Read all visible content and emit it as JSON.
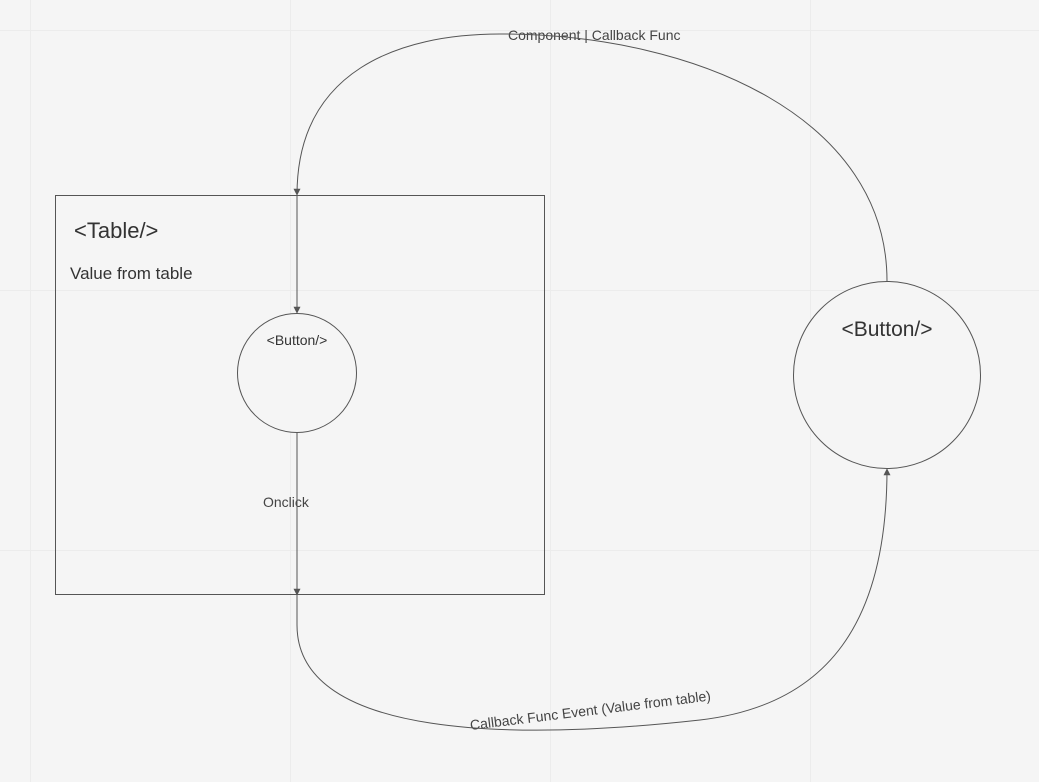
{
  "nodes": {
    "table": {
      "title": "<Table/>",
      "subtitle": "Value from table"
    },
    "inner_button": {
      "label": "<Button/>"
    },
    "outer_button": {
      "label": "<Button/>"
    }
  },
  "edges": {
    "callback_down_into_table": "Component | Callback Func",
    "onclick": "Onclick",
    "callback_event_up": "Callback Func Event (Value from table)"
  }
}
